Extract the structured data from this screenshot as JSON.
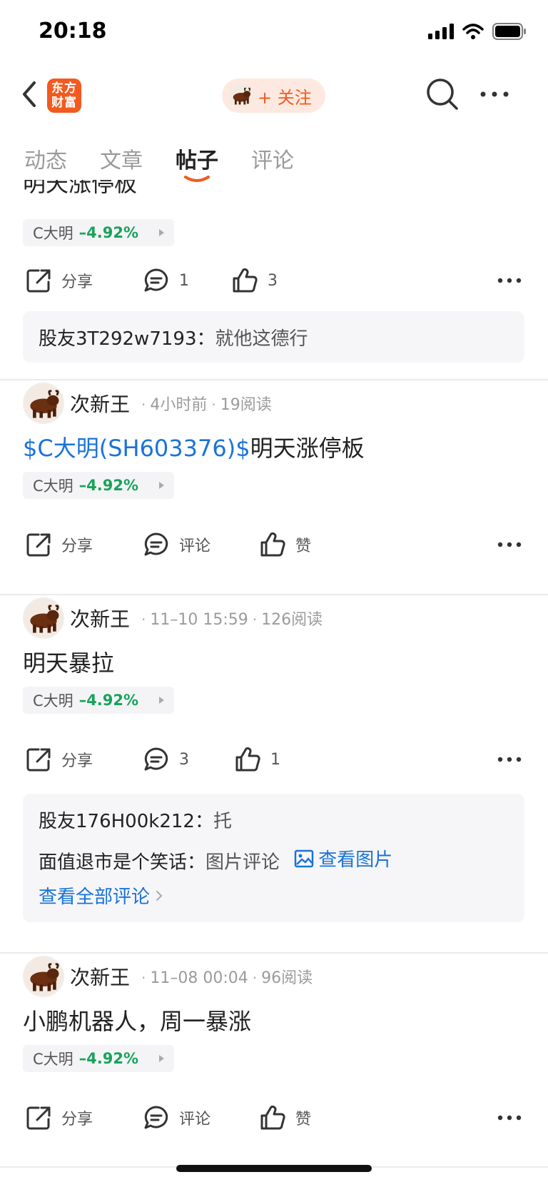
{
  "status_bar": {
    "time": "20:18"
  },
  "header": {
    "logo_line1": "东方",
    "logo_line2": "财富",
    "follow_label": "+ 关注"
  },
  "tabs": [
    {
      "label": "动态"
    },
    {
      "label": "文章"
    },
    {
      "label": "帖子",
      "active": true
    },
    {
      "label": "评论"
    }
  ],
  "posts": [
    {
      "text": "明天涨停板",
      "stock_name": "C大明",
      "stock_pct": "–4.92%",
      "share_label": "分享",
      "comment_label": "1",
      "like_label": "3",
      "comments": [
        {
          "user": "股友3T292w7193：",
          "text": "就他这德行"
        }
      ]
    },
    {
      "author": "次新王",
      "time": "4小时前",
      "reads": "19阅读",
      "link_text": "$C大明(SH603376)$",
      "text": "明天涨停板",
      "stock_name": "C大明",
      "stock_pct": "–4.92%",
      "share_label": "分享",
      "comment_label": "评论",
      "like_label": "赞"
    },
    {
      "author": "次新王",
      "time": "11–10 15:59",
      "reads": "126阅读",
      "text": "明天暴拉",
      "stock_name": "C大明",
      "stock_pct": "–4.92%",
      "share_label": "分享",
      "comment_label": "3",
      "like_label": "1",
      "comments": [
        {
          "user": "股友176H00k212：",
          "text": "托"
        },
        {
          "user": "面值退市是个笑话：",
          "text": "图片评论",
          "image_link": "查看图片"
        }
      ],
      "view_all": "查看全部评论"
    },
    {
      "author": "次新王",
      "time": "11–08 00:04",
      "reads": "96阅读",
      "text": "小鹏机器人，周一暴涨",
      "stock_name": "C大明",
      "stock_pct": "–4.92%",
      "share_label": "分享",
      "comment_label": "评论",
      "like_label": "赞"
    }
  ],
  "colors": {
    "accent": "#f25a1f",
    "link": "#1a73d9",
    "down_green": "#18a35a"
  }
}
